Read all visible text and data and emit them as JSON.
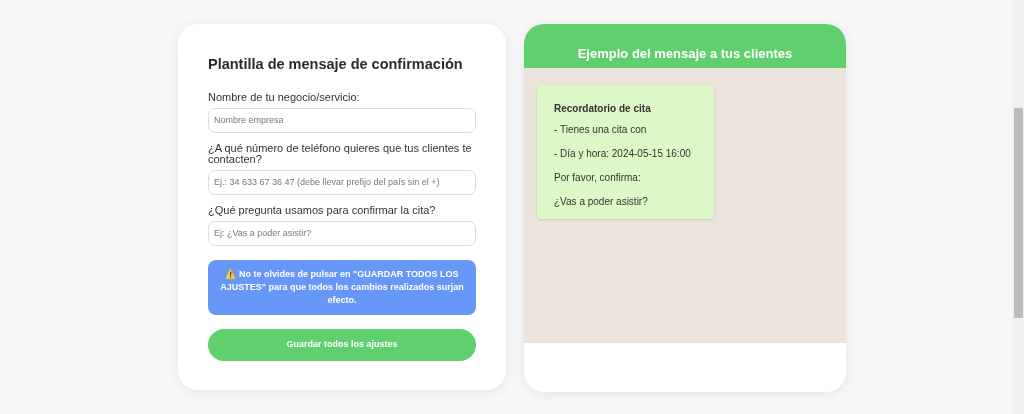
{
  "form": {
    "title": "Plantilla de mensaje de confirmación",
    "fields": [
      {
        "label": "Nombre de tu negocio/servicio:",
        "placeholder": "Nombre empresa"
      },
      {
        "label": "¿A qué número de teléfono quieres que tus clientes te contacten?",
        "placeholder": "Ej.: 34 633 67 36 47 (debe llevar prefijo del país sin el +)"
      },
      {
        "label": "¿Qué pregunta usamos para confirmar la cita?",
        "placeholder": "Ej: ¿Vas a poder asistir?"
      }
    ],
    "warning": "⚠️ No te olvides de pulsar en \"GUARDAR TODOS LOS AJUSTES\" para que todos los cambios realizados surjan efecto.",
    "save_button": "Guardar todos los ajustes"
  },
  "preview": {
    "title": "Ejemplo del mensaje a tus clientes",
    "message": {
      "heading": "Recordatorio de cita",
      "lines": [
        "- Tienes una cita con",
        "- Día y hora: 2024-05-15 16:00",
        "Por favor, confirma:",
        "¿Vas a poder asistir?"
      ]
    }
  }
}
